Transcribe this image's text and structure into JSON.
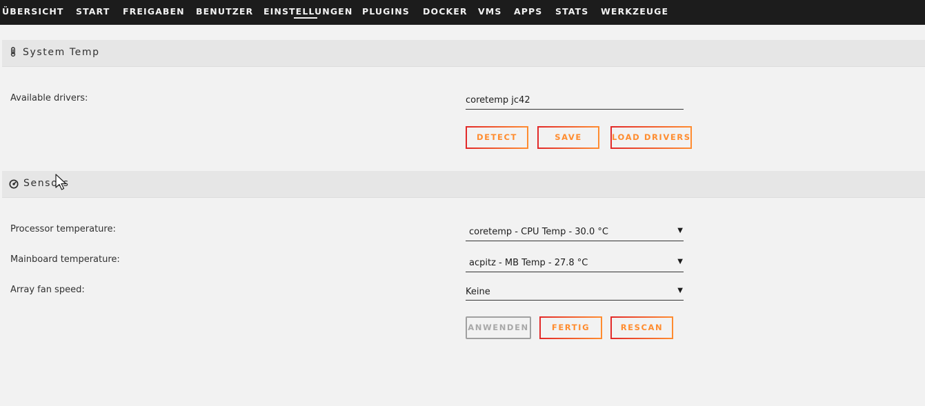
{
  "nav": {
    "items": [
      {
        "label": "ÜBERSICHT"
      },
      {
        "label": "START"
      },
      {
        "label": "FREIGABEN"
      },
      {
        "label": "BENUTZER"
      },
      {
        "label": "EINSTELLUNGEN"
      },
      {
        "label": "PLUGINS"
      },
      {
        "label": "DOCKER"
      },
      {
        "label": "VMS"
      },
      {
        "label": "APPS"
      },
      {
        "label": "STATS"
      },
      {
        "label": "WERKZEUGE"
      }
    ],
    "active": "EINSTELLUNGEN"
  },
  "system_temp": {
    "title": "System Temp",
    "icon": "thermometer-icon",
    "drivers_label": "Available drivers:",
    "drivers_value": "coretemp jc42",
    "buttons": {
      "detect": "DETECT",
      "save": "SAVE",
      "load_drivers": "LOAD DRIVERS"
    }
  },
  "sensors": {
    "title": "Sensors",
    "icon": "gauge-icon",
    "processor_label": "Processor temperature:",
    "processor_value": "coretemp - CPU Temp - 30.0 °C",
    "mainboard_label": "Mainboard temperature:",
    "mainboard_value": "acpitz - MB Temp - 27.8 °C",
    "fan_label": "Array fan speed:",
    "fan_value": "Keine",
    "buttons": {
      "apply": "ANWENDEN",
      "done": "FERTIG",
      "rescan": "RESCAN"
    }
  },
  "colors": {
    "nav_bg": "#1c1c1c",
    "page_bg": "#f2f2f2",
    "button_gradient_start": "#e22828",
    "button_gradient_end": "#ff8c2f"
  }
}
